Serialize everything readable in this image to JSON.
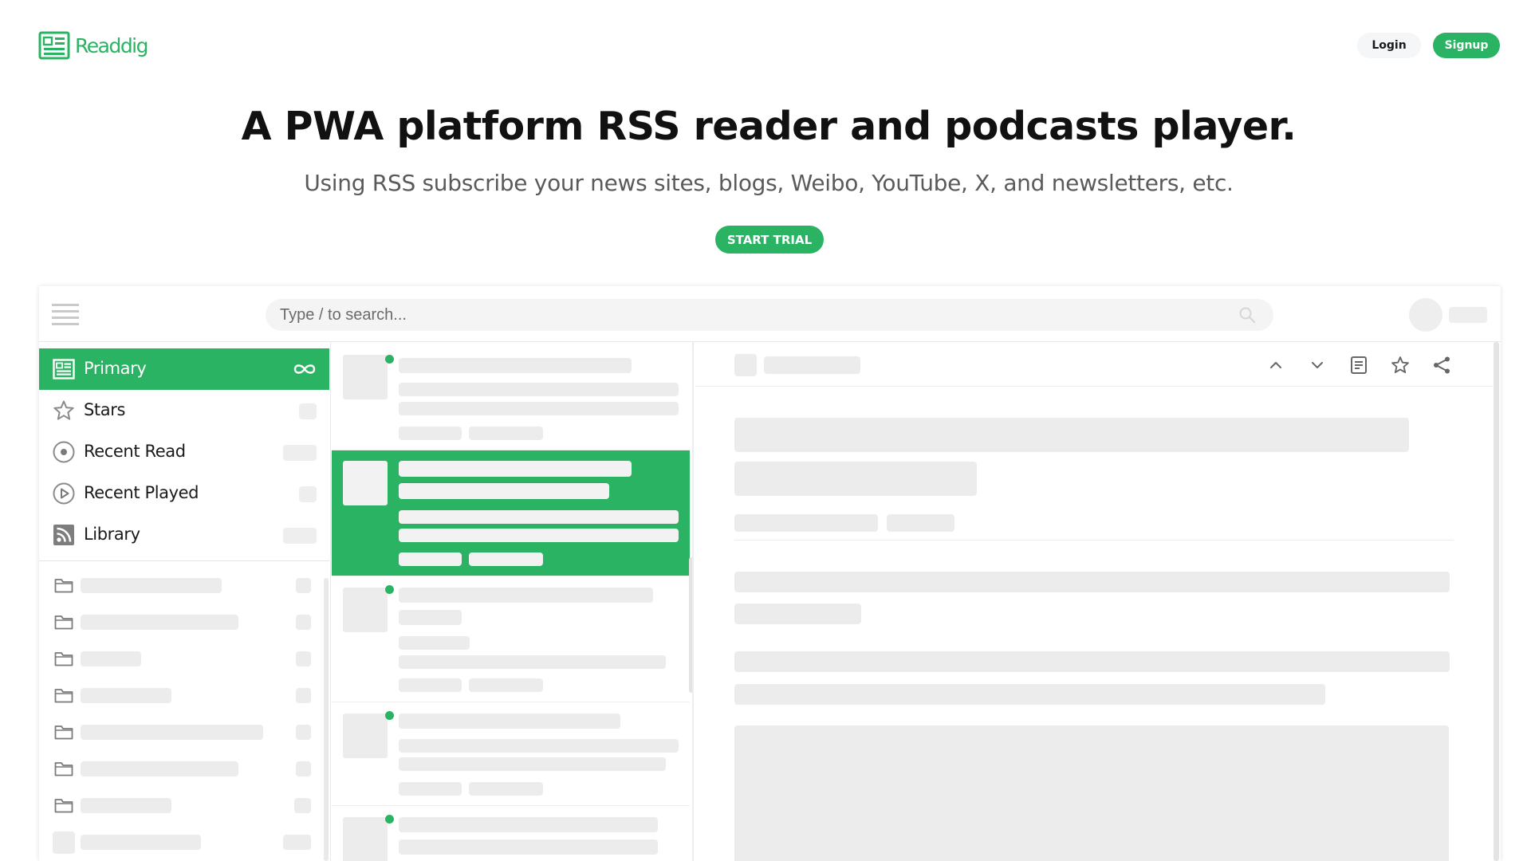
{
  "brand": {
    "name": "Readdig",
    "accent": "#2ab362"
  },
  "nav": {
    "login_label": "Login",
    "signup_label": "Signup"
  },
  "hero": {
    "title": "A PWA platform RSS reader and podcasts player.",
    "subtitle": "Using RSS subscribe your news sites, blogs, Weibo, YouTube, X, and newsletters, etc.",
    "cta_label": "START TRIAL"
  },
  "app": {
    "search": {
      "placeholder": "Type / to search...",
      "icon": "search-icon"
    },
    "menu_icon": "hamburger-icon",
    "sidebar": {
      "items": [
        {
          "label": "Primary",
          "icon": "feed-list-icon",
          "active": true,
          "badge_icon": "infinity-icon"
        },
        {
          "label": "Stars",
          "icon": "star-icon"
        },
        {
          "label": "Recent Read",
          "icon": "record-icon"
        },
        {
          "label": "Recent Played",
          "icon": "play-circle-icon"
        },
        {
          "label": "Library",
          "icon": "rss-icon"
        }
      ],
      "folders_icon": "folder-icon"
    },
    "reader_toolbar": {
      "icons": [
        "chevron-up-icon",
        "chevron-down-icon",
        "document-icon",
        "star-icon",
        "share-icon"
      ]
    }
  }
}
